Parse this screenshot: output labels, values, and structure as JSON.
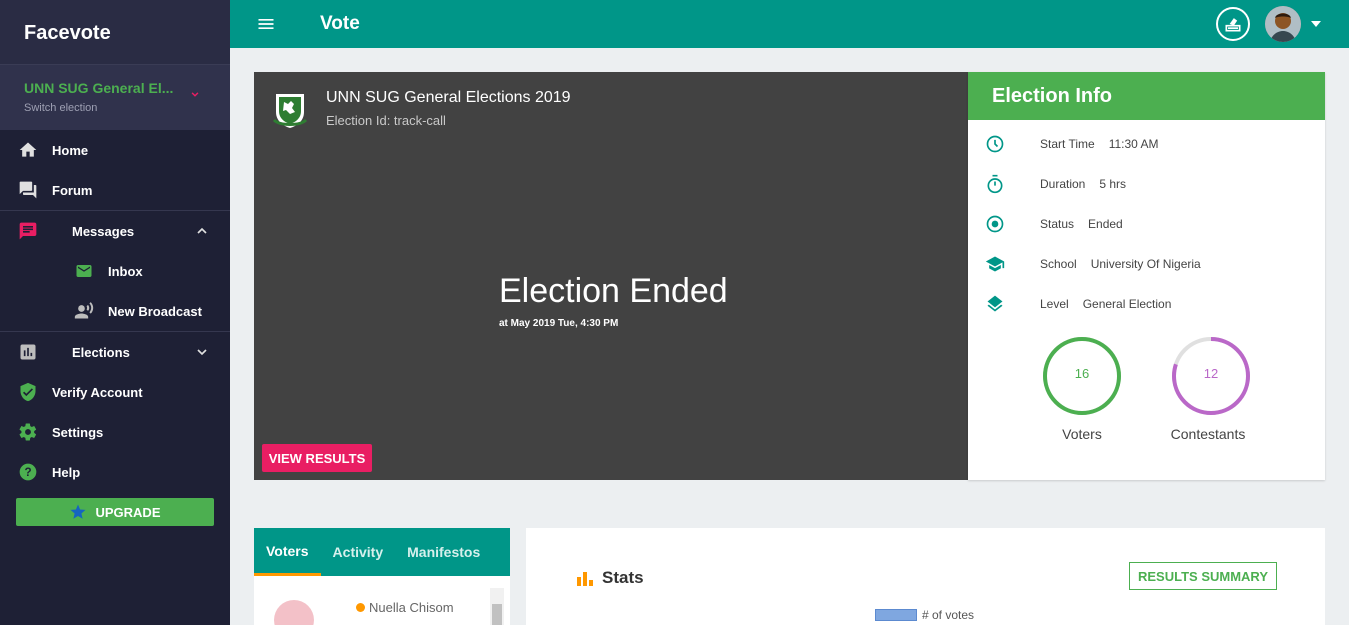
{
  "sidebar": {
    "brand": "Facevote",
    "election": {
      "name": "UNN SUG General El...",
      "sub": "Switch election"
    },
    "items": [
      {
        "label": "Home"
      },
      {
        "label": "Forum"
      },
      {
        "label": "Messages"
      },
      {
        "label": "Inbox"
      },
      {
        "label": "New Broadcast"
      },
      {
        "label": "Elections"
      },
      {
        "label": "Verify Account"
      },
      {
        "label": "Settings"
      },
      {
        "label": "Help"
      }
    ],
    "upgrade": "UPGRADE"
  },
  "topbar": {
    "title": "Vote"
  },
  "hero": {
    "title": "UNN SUG General Elections 2019",
    "election_id": "Election Id: track-call",
    "status_big": "Election Ended",
    "ended_at": "at May 2019 Tue, 4:30 PM",
    "view_results": "VIEW RESULTS"
  },
  "info": {
    "title": "Election Info",
    "rows": [
      {
        "key": "Start Time",
        "value": "11:30 AM",
        "icon": "clock-icon"
      },
      {
        "key": "Duration",
        "value": "5 hrs",
        "icon": "timer-icon"
      },
      {
        "key": "Status",
        "value": "Ended",
        "icon": "status-icon"
      },
      {
        "key": "School",
        "value": "University Of Nigeria",
        "icon": "school-icon"
      },
      {
        "key": "Level",
        "value": "General Election",
        "icon": "layers-icon"
      }
    ],
    "voters": {
      "count": "16",
      "label": "Voters",
      "fill": 1.0,
      "color": "#4caf50"
    },
    "contestants": {
      "count": "12",
      "label": "Contestants",
      "fill": 0.8,
      "color": "#ba68c8"
    }
  },
  "tabs": {
    "items": [
      "Voters",
      "Activity",
      "Manifestos"
    ],
    "active": "Voters",
    "voter_name": "Nuella Chisom"
  },
  "stats": {
    "title": "Stats",
    "results_summary": "RESULTS SUMMARY",
    "legend": "# of votes"
  },
  "colors": {
    "teal": "#009688",
    "green": "#4caf50",
    "pink": "#e91e63",
    "purple": "#ba68c8"
  }
}
